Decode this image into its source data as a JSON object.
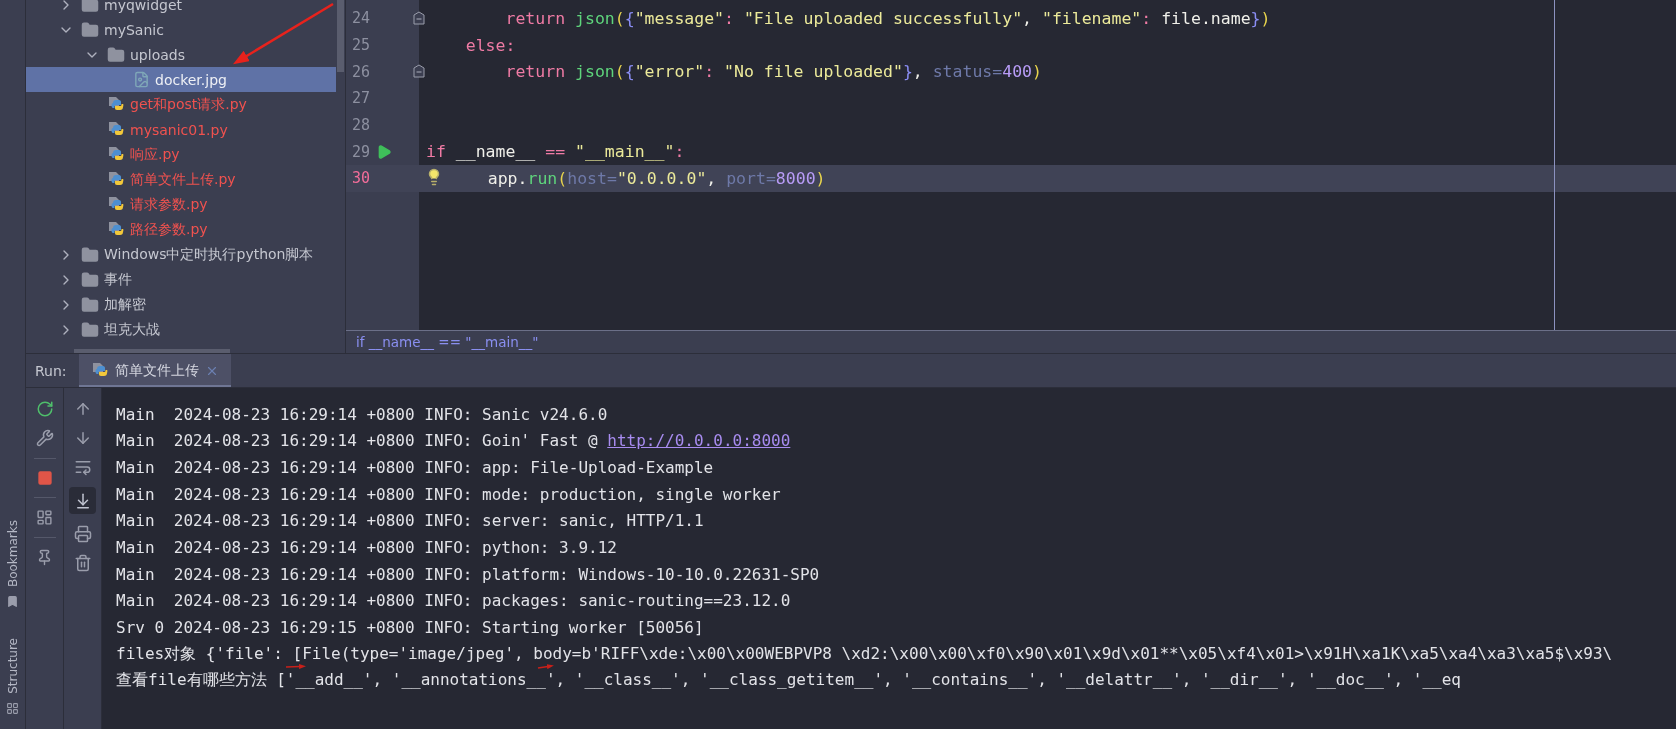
{
  "project_tree": {
    "items": [
      {
        "name": "myqwidget",
        "kind": "folder",
        "expanded": false,
        "selected": false,
        "color": "#c5c7d0"
      },
      {
        "name": "mySanic",
        "kind": "folder",
        "expanded": true,
        "selected": false,
        "color": "#c5c7d0",
        "children": [
          {
            "name": "uploads",
            "kind": "folder",
            "expanded": true,
            "selected": false,
            "color": "#c5c7d0",
            "children": [
              {
                "name": "docker.jpg",
                "kind": "image",
                "selected": true,
                "color": "#eef0f5"
              }
            ]
          },
          {
            "name": "get和post请求.py",
            "kind": "python",
            "selected": false,
            "color": "#f0524f"
          },
          {
            "name": "mysanic01.py",
            "kind": "python",
            "selected": false,
            "color": "#f0524f"
          },
          {
            "name": "响应.py",
            "kind": "python",
            "selected": false,
            "color": "#f0524f"
          },
          {
            "name": "简单文件上传.py",
            "kind": "python",
            "selected": false,
            "color": "#f0524f"
          },
          {
            "name": "请求参数.py",
            "kind": "python",
            "selected": false,
            "color": "#f0524f"
          },
          {
            "name": "路径参数.py",
            "kind": "python",
            "selected": false,
            "color": "#f0524f"
          }
        ]
      },
      {
        "name": "Windows中定时执行python脚本",
        "kind": "folder",
        "expanded": false,
        "selected": false,
        "color": "#c5c7d0"
      },
      {
        "name": "事件",
        "kind": "folder",
        "expanded": false,
        "selected": false,
        "color": "#c5c7d0"
      },
      {
        "name": "加解密",
        "kind": "folder",
        "expanded": false,
        "selected": false,
        "color": "#c5c7d0"
      },
      {
        "name": "坦克大战",
        "kind": "folder",
        "expanded": false,
        "selected": false,
        "color": "#c5c7d0"
      }
    ]
  },
  "editor": {
    "lines": [
      {
        "number": "24",
        "current": false,
        "runnable": false,
        "fold": true,
        "hint": false,
        "tokens": [
          {
            "text": "        return ",
            "kind": "keyword"
          },
          {
            "text": "json",
            "kind": "function"
          },
          {
            "text": "(",
            "kind": "paren"
          },
          {
            "text": "{",
            "kind": "brace"
          },
          {
            "text": "\"message\"",
            "kind": "string"
          },
          {
            "text": ": ",
            "kind": "operator"
          },
          {
            "text": "\"File uploaded successfully\"",
            "kind": "string"
          },
          {
            "text": ", ",
            "kind": "plain"
          },
          {
            "text": "\"filename\"",
            "kind": "string"
          },
          {
            "text": ":",
            "kind": "operator"
          },
          {
            "text": " file.name",
            "kind": "plain"
          },
          {
            "text": "}",
            "kind": "brace"
          },
          {
            "text": ")",
            "kind": "paren"
          }
        ]
      },
      {
        "number": "25",
        "current": false,
        "runnable": false,
        "fold": false,
        "hint": false,
        "tokens": [
          {
            "text": "    else",
            "kind": "keyword"
          },
          {
            "text": ":",
            "kind": "operator"
          }
        ]
      },
      {
        "number": "26",
        "current": false,
        "runnable": false,
        "fold": true,
        "hint": false,
        "tokens": [
          {
            "text": "        return ",
            "kind": "keyword"
          },
          {
            "text": "json",
            "kind": "function"
          },
          {
            "text": "(",
            "kind": "paren"
          },
          {
            "text": "{",
            "kind": "brace"
          },
          {
            "text": "\"error\"",
            "kind": "string"
          },
          {
            "text": ": ",
            "kind": "operator"
          },
          {
            "text": "\"No file uploaded\"",
            "kind": "string"
          },
          {
            "text": "}",
            "kind": "brace"
          },
          {
            "text": ", ",
            "kind": "plain"
          },
          {
            "text": "status=",
            "kind": "param"
          },
          {
            "text": "400",
            "kind": "number"
          },
          {
            "text": ")",
            "kind": "paren"
          }
        ]
      },
      {
        "number": "27",
        "current": false,
        "runnable": false,
        "fold": false,
        "hint": false
      },
      {
        "number": "28",
        "current": false,
        "runnable": false,
        "fold": false,
        "hint": false
      },
      {
        "number": "29",
        "current": false,
        "runnable": true,
        "fold": false,
        "hint": false,
        "tokens": [
          {
            "text": "if",
            "kind": "keyword"
          },
          {
            "text": " __name__ ",
            "kind": "plain"
          },
          {
            "text": "== ",
            "kind": "operator"
          },
          {
            "text": "\"__main__\"",
            "kind": "string"
          },
          {
            "text": ":",
            "kind": "operator"
          }
        ]
      },
      {
        "number": "30",
        "current": true,
        "runnable": false,
        "fold": false,
        "hint": true,
        "tokens": [
          {
            "text": "    app.",
            "kind": "plain"
          },
          {
            "text": "run",
            "kind": "function"
          },
          {
            "text": "(",
            "kind": "paren"
          },
          {
            "text": "host=",
            "kind": "param"
          },
          {
            "text": "\"0.0.0.0\"",
            "kind": "string"
          },
          {
            "text": ", ",
            "kind": "plain"
          },
          {
            "text": "port=",
            "kind": "param"
          },
          {
            "text": "8000",
            "kind": "number"
          },
          {
            "text": ")",
            "kind": "paren"
          }
        ]
      }
    ],
    "breadcrumb": "if __name__ == \"__main__\""
  },
  "run_panel": {
    "label": "Run:",
    "tabs": [
      {
        "title": "简单文件上传",
        "selected": true
      }
    ],
    "scroll_to_end": true,
    "console": [
      {
        "text": "Main  2024-08-23 16:29:14 +0800 INFO: Sanic v24.6.0"
      },
      {
        "text": "Main  2024-08-23 16:29:14 +0800 INFO: Goin' Fast @",
        "link": "http://0.0.0.0:8000"
      },
      {
        "text": "Main  2024-08-23 16:29:14 +0800 INFO: app: File-Upload-Example"
      },
      {
        "text": "Main  2024-08-23 16:29:14 +0800 INFO: mode: production, single worker"
      },
      {
        "text": "Main  2024-08-23 16:29:14 +0800 INFO: server: sanic, HTTP/1.1"
      },
      {
        "text": "Main  2024-08-23 16:29:14 +0800 INFO: python: 3.9.12"
      },
      {
        "text": "Main  2024-08-23 16:29:14 +0800 INFO: platform: Windows-10-10.0.22631-SP0"
      },
      {
        "text": "Main  2024-08-23 16:29:14 +0800 INFO: packages: sanic-routing==23.12.0"
      },
      {
        "text": "Srv 0 2024-08-23 16:29:15 +0800 INFO: Starting worker [50056]"
      },
      {
        "text": "files对象 {'file': [File(type='image/jpeg', body=b'RIFF\\xde:\\x00\\x00WEBPVP8 \\xd2:\\x00\\x00\\xf0\\x90\\x01\\x9d\\x01**\\x05\\xf4\\x01>\\x91H\\xa1K\\xa5\\xa4\\xa3\\xa5$\\x93\\"
      },
      {
        "text": "查看file有哪些方法 ['__add__', '__annotations__', '__class__', '__class_getitem__', '__contains__', '__delattr__', '__dir__', '__doc__', '__eq"
      }
    ]
  },
  "tool_strip": [
    "Bookmarks",
    "Structure"
  ]
}
